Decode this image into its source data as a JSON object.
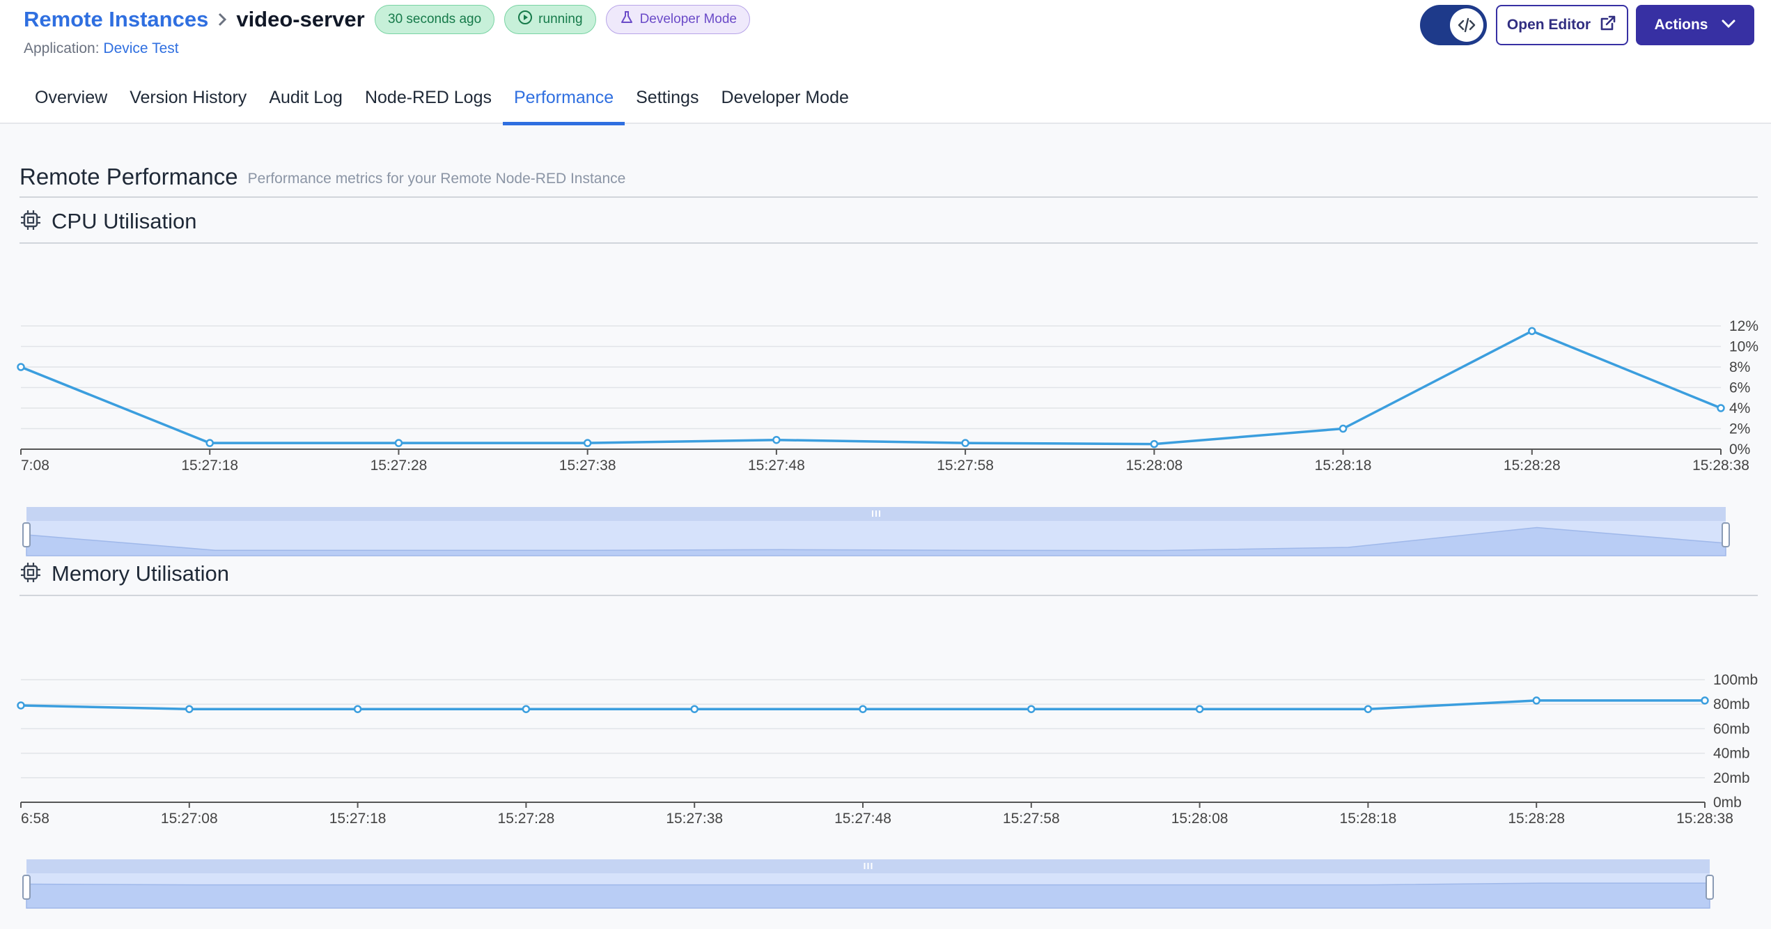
{
  "breadcrumb": {
    "parent": "Remote Instances",
    "current": "video-server"
  },
  "pills": {
    "updated": "30 seconds ago",
    "status": "running",
    "mode": "Developer Mode"
  },
  "application": {
    "label": "Application:",
    "name": "Device Test"
  },
  "toolbar": {
    "open_editor": "Open Editor",
    "actions": "Actions"
  },
  "tabs": [
    "Overview",
    "Version History",
    "Audit Log",
    "Node-RED Logs",
    "Performance",
    "Settings",
    "Developer Mode"
  ],
  "active_tab": "Performance",
  "section": {
    "title": "Remote Performance",
    "description": "Performance metrics for your Remote Node-RED Instance"
  },
  "colors": {
    "accent": "#2f6fe0",
    "primary": "#3730a3",
    "line": "#3b9ede",
    "brush": "#d6e2fb"
  },
  "chart_data": [
    {
      "type": "line",
      "title": "CPU Utilisation",
      "x": [
        "7:08",
        "15:27:18",
        "15:27:28",
        "15:27:38",
        "15:27:48",
        "15:27:58",
        "15:28:08",
        "15:28:18",
        "15:28:28",
        "15:28:38"
      ],
      "values": [
        8.0,
        0.6,
        0.6,
        0.6,
        0.9,
        0.6,
        0.5,
        2.0,
        11.5,
        4.0
      ],
      "y_ticks": [
        "0%",
        "2%",
        "4%",
        "6%",
        "8%",
        "10%",
        "12%"
      ],
      "ylim": [
        0,
        12
      ],
      "grid": true
    },
    {
      "type": "line",
      "title": "Memory Utilisation",
      "x": [
        "6:58",
        "15:27:08",
        "15:27:18",
        "15:27:28",
        "15:27:38",
        "15:27:48",
        "15:27:58",
        "15:28:08",
        "15:28:18",
        "15:28:28",
        "15:28:38"
      ],
      "values": [
        79,
        76,
        76,
        76,
        76,
        76,
        76,
        76,
        76,
        83,
        83
      ],
      "y_ticks": [
        "0mb",
        "20mb",
        "40mb",
        "60mb",
        "80mb",
        "100mb"
      ],
      "ylim": [
        0,
        100
      ],
      "grid": true
    }
  ]
}
